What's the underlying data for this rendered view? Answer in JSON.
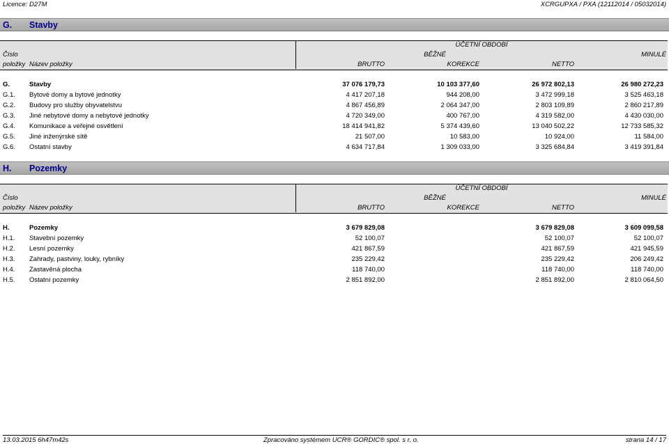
{
  "header": {
    "licence": "Licence: D27M",
    "report": "XCRGUPXA / PXA  (12112014 / 05032014)"
  },
  "columns": {
    "ucetni_obdobi": "ÚČETNÍ OBDOBÍ",
    "cislo": "Číslo",
    "bezne": "BĚŽNÉ",
    "minule": "MINULÉ",
    "polozky": "položky",
    "nazev": "Název položky",
    "brutto": "BRUTTO",
    "korekce": "KOREKCE",
    "netto": "NETTO"
  },
  "sections": [
    {
      "code": "G.",
      "title": "Stavby",
      "rows": [
        {
          "code": "G.",
          "name": "Stavby",
          "brutto": "37 076 179,73",
          "korekce": "10 103 377,60",
          "netto": "26 972 802,13",
          "minule": "26 980 272,23"
        },
        {
          "code": "G.1.",
          "name": "Bytové domy a bytové jednotky",
          "brutto": "4 417 207,18",
          "korekce": "944 208,00",
          "netto": "3 472 999,18",
          "minule": "3 525 463,18"
        },
        {
          "code": "G.2.",
          "name": "Budovy pro služby obyvatelstvu",
          "brutto": "4 867 456,89",
          "korekce": "2 064 347,00",
          "netto": "2 803 109,89",
          "minule": "2 860 217,89"
        },
        {
          "code": "G.3.",
          "name": "Jiné nebytové domy a nebytové jednotky",
          "brutto": "4 720 349,00",
          "korekce": "400 767,00",
          "netto": "4 319 582,00",
          "minule": "4 430 030,00"
        },
        {
          "code": "G.4.",
          "name": "Komunikace a veřejné osvětlení",
          "brutto": "18 414 941,82",
          "korekce": "5 374 439,60",
          "netto": "13 040 502,22",
          "minule": "12 733 585,32"
        },
        {
          "code": "G.5.",
          "name": "Jiné inženýrské sítě",
          "brutto": "21 507,00",
          "korekce": "10 583,00",
          "netto": "10 924,00",
          "minule": "11 584,00"
        },
        {
          "code": "G.6.",
          "name": "Ostatní stavby",
          "brutto": "4 634 717,84",
          "korekce": "1 309 033,00",
          "netto": "3 325 684,84",
          "minule": "3 419 391,84"
        }
      ]
    },
    {
      "code": "H.",
      "title": "Pozemky",
      "rows": [
        {
          "code": "H.",
          "name": "Pozemky",
          "brutto": "3 679 829,08",
          "korekce": "",
          "netto": "3 679 829,08",
          "minule": "3 609 099,58"
        },
        {
          "code": "H.1.",
          "name": "Stavební pozemky",
          "brutto": "52 100,07",
          "korekce": "",
          "netto": "52 100,07",
          "minule": "52 100,07"
        },
        {
          "code": "H.2.",
          "name": "Lesní pozemky",
          "brutto": "421 867,59",
          "korekce": "",
          "netto": "421 867,59",
          "minule": "421 945,59"
        },
        {
          "code": "H.3.",
          "name": "Zahrady, pastviny, louky, rybníky",
          "brutto": "235 229,42",
          "korekce": "",
          "netto": "235 229,42",
          "minule": "206 249,42"
        },
        {
          "code": "H.4.",
          "name": "Zastavěná plocha",
          "brutto": "118 740,00",
          "korekce": "",
          "netto": "118 740,00",
          "minule": "118 740,00"
        },
        {
          "code": "H.5.",
          "name": "Ostatní pozemky",
          "brutto": "2 851 892,00",
          "korekce": "",
          "netto": "2 851 892,00",
          "minule": "2 810 064,50"
        }
      ]
    }
  ],
  "footer": {
    "timestamp": "13.03.2015 6h47m42s",
    "processed": "Zpracováno systémem UCR® GORDIC® spol. s  r. o.",
    "page": "strana 14 / 17"
  }
}
